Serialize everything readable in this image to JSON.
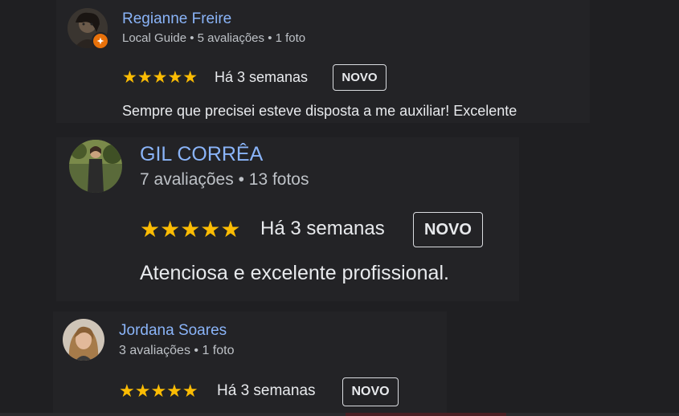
{
  "colors": {
    "background": "#1f1f22",
    "card": "#232326",
    "name": "#8ab4f8",
    "meta": "#bdc1c6",
    "star": "#fbbc04",
    "text": "#e8eaed",
    "local_guide_badge": "#e8710a"
  },
  "reviews": [
    {
      "name": "Regianne Freire",
      "meta": "Local Guide • 5 avaliações • 1 foto",
      "stars": "★★★★★",
      "rating": 5,
      "date": "Há 3 semanas",
      "badge": "NOVO",
      "text": "Sempre que precisei esteve disposta a me auxiliar! Excelente",
      "avatar_icon": "profile-photo-icon",
      "local_guide_icon": "local-guide-star-icon"
    },
    {
      "name": "GIL CORRÊA",
      "meta": "7 avaliações • 13 fotos",
      "stars": "★★★★★",
      "rating": 5,
      "date": "Há 3 semanas",
      "badge": "NOVO",
      "text": "Atenciosa e excelente profissional.",
      "avatar_icon": "profile-photo-icon"
    },
    {
      "name": "Jordana Soares",
      "meta": "3 avaliações • 1 foto",
      "stars": "★★★★★",
      "rating": 5,
      "date": "Há 3 semanas",
      "badge": "NOVO",
      "avatar_icon": "profile-photo-icon"
    }
  ]
}
